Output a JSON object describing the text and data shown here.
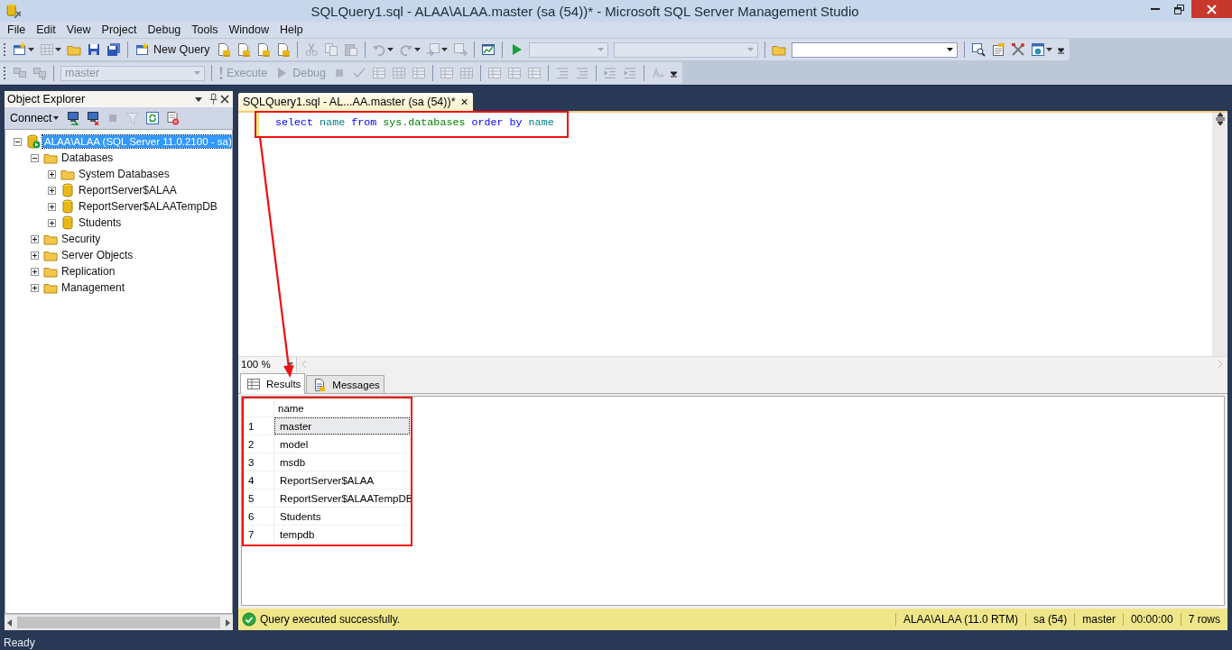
{
  "window": {
    "title": "SQLQuery1.sql - ALAA\\ALAA.master (sa (54))* - Microsoft SQL Server Management Studio"
  },
  "menu": [
    "File",
    "Edit",
    "View",
    "Project",
    "Debug",
    "Tools",
    "Window",
    "Help"
  ],
  "toolbar_standard": [
    {
      "kind": "grip"
    },
    {
      "kind": "split-icon",
      "disabled": false
    },
    {
      "kind": "split-icon",
      "disabled": true
    },
    {
      "kind": "icon",
      "disabled": false
    },
    {
      "kind": "icon",
      "disabled": false
    },
    {
      "kind": "icon",
      "disabled": false
    },
    {
      "kind": "separator"
    },
    {
      "kind": "button",
      "label": "New Query",
      "disabled": false
    },
    {
      "kind": "icon",
      "disabled": false
    },
    {
      "kind": "icon",
      "disabled": false
    },
    {
      "kind": "icon",
      "disabled": false
    },
    {
      "kind": "icon",
      "disabled": false
    },
    {
      "kind": "separator"
    },
    {
      "kind": "icon",
      "disabled": true
    },
    {
      "kind": "icon",
      "disabled": true
    },
    {
      "kind": "icon",
      "disabled": true
    },
    {
      "kind": "separator"
    },
    {
      "kind": "split-icon",
      "disabled": true
    },
    {
      "kind": "split-icon",
      "disabled": true
    },
    {
      "kind": "split-icon",
      "disabled": true
    },
    {
      "kind": "icon",
      "disabled": true
    },
    {
      "kind": "separator"
    },
    {
      "kind": "icon",
      "disabled": false
    },
    {
      "kind": "separator"
    },
    {
      "kind": "icon",
      "disabled": false
    },
    {
      "kind": "combo",
      "disabled": true
    },
    {
      "kind": "combo",
      "disabled": true
    },
    {
      "kind": "separator"
    },
    {
      "kind": "icon",
      "disabled": false
    },
    {
      "kind": "combo",
      "disabled": false
    },
    {
      "kind": "separator"
    },
    {
      "kind": "icon",
      "disabled": false
    },
    {
      "kind": "icon",
      "disabled": false
    },
    {
      "kind": "icon",
      "disabled": false
    },
    {
      "kind": "split-icon",
      "disabled": false
    },
    {
      "kind": "overflow"
    }
  ],
  "toolbar_editor": [
    {
      "kind": "grip"
    },
    {
      "kind": "icon",
      "disabled": true
    },
    {
      "kind": "icon",
      "disabled": true
    },
    {
      "kind": "separator"
    },
    {
      "kind": "combo",
      "disabled": true,
      "value": "master"
    },
    {
      "kind": "separator"
    },
    {
      "kind": "button",
      "label": "Execute",
      "disabled": true
    },
    {
      "kind": "button",
      "label": "Debug",
      "disabled": true
    },
    {
      "kind": "icon",
      "disabled": true
    },
    {
      "kind": "icon",
      "disabled": true
    },
    {
      "kind": "icon",
      "disabled": true
    },
    {
      "kind": "icon",
      "disabled": true
    },
    {
      "kind": "icon",
      "disabled": true
    },
    {
      "kind": "separator"
    },
    {
      "kind": "icon",
      "disabled": true
    },
    {
      "kind": "icon",
      "disabled": true
    },
    {
      "kind": "separator"
    },
    {
      "kind": "icon",
      "disabled": true
    },
    {
      "kind": "icon",
      "disabled": true
    },
    {
      "kind": "icon",
      "disabled": true
    },
    {
      "kind": "separator"
    },
    {
      "kind": "icon",
      "disabled": true
    },
    {
      "kind": "icon",
      "disabled": true
    },
    {
      "kind": "separator"
    },
    {
      "kind": "icon",
      "disabled": true
    },
    {
      "kind": "icon",
      "disabled": true
    },
    {
      "kind": "separator"
    },
    {
      "kind": "icon",
      "disabled": true
    },
    {
      "kind": "overflow"
    }
  ],
  "object_explorer": {
    "title": "Object Explorer",
    "connect_label": "Connect",
    "tree": [
      {
        "label": "ALAA\\ALAA (SQL Server 11.0.2100 - sa)",
        "kind": "server",
        "expanded": true,
        "selected": true,
        "children": [
          {
            "label": "Databases",
            "kind": "folder",
            "expanded": true,
            "selected": false,
            "children": [
              {
                "label": "System Databases",
                "kind": "folder",
                "expanded": false,
                "selected": false
              },
              {
                "label": "ReportServer$ALAA",
                "kind": "database",
                "expanded": false,
                "selected": false
              },
              {
                "label": "ReportServer$ALAATempDB",
                "kind": "database",
                "expanded": false,
                "selected": false
              },
              {
                "label": "Students",
                "kind": "database",
                "expanded": false,
                "selected": false
              }
            ]
          },
          {
            "label": "Security",
            "kind": "folder",
            "expanded": false,
            "selected": false
          },
          {
            "label": "Server Objects",
            "kind": "folder",
            "expanded": false,
            "selected": false
          },
          {
            "label": "Replication",
            "kind": "folder",
            "expanded": false,
            "selected": false
          },
          {
            "label": "Management",
            "kind": "folder",
            "expanded": false,
            "selected": false
          }
        ]
      }
    ]
  },
  "editor": {
    "tab": {
      "title": "SQLQuery1.sql - AL...AA.master (sa (54))*",
      "close": "×"
    },
    "query": [
      {
        "text": "select ",
        "kind": "keyword"
      },
      {
        "text": "name ",
        "kind": "identifier"
      },
      {
        "text": "from ",
        "kind": "keyword"
      },
      {
        "text": "sys.databases ",
        "kind": "system"
      },
      {
        "text": "order ",
        "kind": "keyword"
      },
      {
        "text": "by ",
        "kind": "keyword"
      },
      {
        "text": "name",
        "kind": "identifier"
      }
    ],
    "highlighted": true,
    "arrow_to_results": true,
    "zoom": "100 %"
  },
  "results": {
    "tabs": [
      {
        "label": "Results",
        "selected": true
      },
      {
        "label": "Messages",
        "selected": false
      }
    ],
    "highlighted": true,
    "columns": [
      "name"
    ],
    "rows": [
      {
        "number": "1",
        "cells": [
          "master"
        ],
        "selected": true
      },
      {
        "number": "2",
        "cells": [
          "model"
        ],
        "selected": false
      },
      {
        "number": "3",
        "cells": [
          "msdb"
        ],
        "selected": false
      },
      {
        "number": "4",
        "cells": [
          "ReportServer$ALAA"
        ],
        "selected": false
      },
      {
        "number": "5",
        "cells": [
          "ReportServer$ALAATempDB"
        ],
        "selected": false
      },
      {
        "number": "6",
        "cells": [
          "Students"
        ],
        "selected": false
      },
      {
        "number": "7",
        "cells": [
          "tempdb"
        ],
        "selected": false
      }
    ]
  },
  "query_status": {
    "message": "Query executed successfully.",
    "cells": [
      "ALAA\\ALAA (11.0 RTM)",
      "sa (54)",
      "master",
      "00:00:00",
      "7 rows"
    ]
  },
  "status_bar": "Ready"
}
